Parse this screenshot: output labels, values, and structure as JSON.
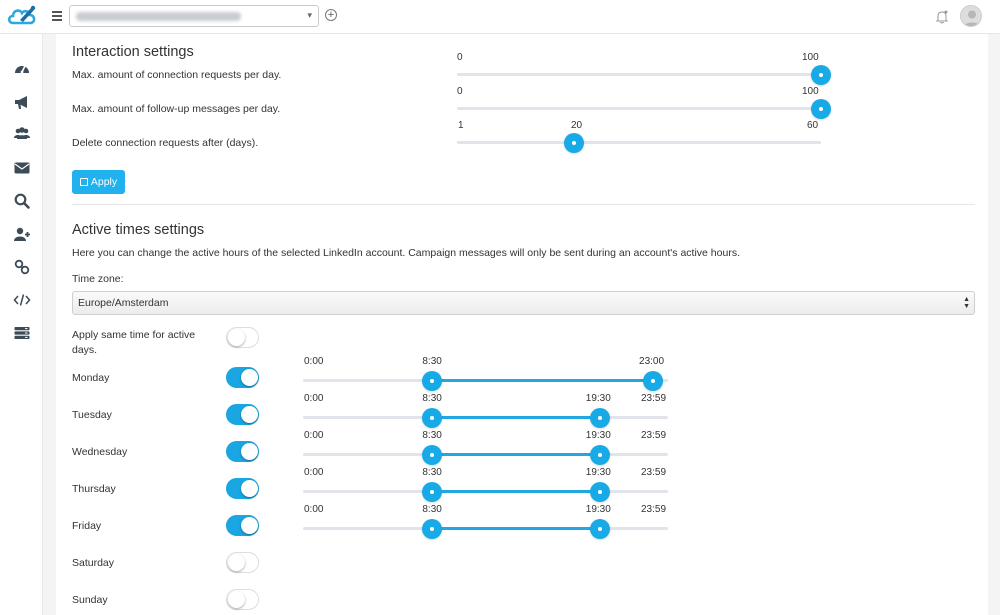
{
  "header": {
    "account_placeholder": "",
    "account_caret": "▾",
    "add_account_glyph": "+"
  },
  "sidebar": {
    "items": [
      {
        "icon": "dashboard-icon"
      },
      {
        "icon": "megaphone-icon"
      },
      {
        "icon": "users-icon"
      },
      {
        "icon": "envelope-icon"
      },
      {
        "icon": "search-icon"
      },
      {
        "icon": "add-user-icon"
      },
      {
        "icon": "link-icon"
      },
      {
        "icon": "code-icon"
      },
      {
        "icon": "server-icon"
      }
    ]
  },
  "interaction": {
    "title": "Interaction settings",
    "sliders": [
      {
        "label": "Max. amount of connection requests per day.",
        "min": "0",
        "max": "100",
        "min_value": 0,
        "max_value": 100,
        "value": 100
      },
      {
        "label": "Max. amount of follow-up messages per day.",
        "min": "0",
        "max": "100",
        "min_value": 0,
        "max_value": 100,
        "value": 100
      },
      {
        "label": "Delete connection requests after (days).",
        "min": "1",
        "max": "60",
        "min_value": 1,
        "max_value": 60,
        "value": 20,
        "value_label": "20"
      }
    ],
    "apply_label": "Apply"
  },
  "active_times": {
    "title": "Active times settings",
    "description": "Here you can change the active hours of the selected LinkedIn account. Campaign messages will only be sent during an account's active hours.",
    "timezone_label": "Time zone:",
    "timezone_value": "Europe/Amsterdam",
    "same_time_label": "Apply same time for active days.",
    "same_time_on": false,
    "days": [
      {
        "name": "Monday",
        "on": true,
        "range": {
          "min": "0:00",
          "start": "8:30",
          "end": "23:00",
          "start_min": 510,
          "end_min": 1380
        }
      },
      {
        "name": "Tuesday",
        "on": true,
        "range": {
          "min": "0:00",
          "start": "8:30",
          "end": "19:30",
          "max": "23:59",
          "start_min": 510,
          "end_min": 1170
        }
      },
      {
        "name": "Wednesday",
        "on": true,
        "range": {
          "min": "0:00",
          "start": "8:30",
          "end": "19:30",
          "max": "23:59",
          "start_min": 510,
          "end_min": 1170
        }
      },
      {
        "name": "Thursday",
        "on": true,
        "range": {
          "min": "0:00",
          "start": "8:30",
          "end": "19:30",
          "max": "23:59",
          "start_min": 510,
          "end_min": 1170
        }
      },
      {
        "name": "Friday",
        "on": true,
        "range": {
          "min": "0:00",
          "start": "8:30",
          "end": "19:30",
          "max": "23:59",
          "start_min": 510,
          "end_min": 1170
        }
      },
      {
        "name": "Saturday",
        "on": false
      },
      {
        "name": "Sunday",
        "on": false
      }
    ]
  },
  "colors": {
    "accent": "#19a6e2",
    "track": "#e1e4ea"
  }
}
